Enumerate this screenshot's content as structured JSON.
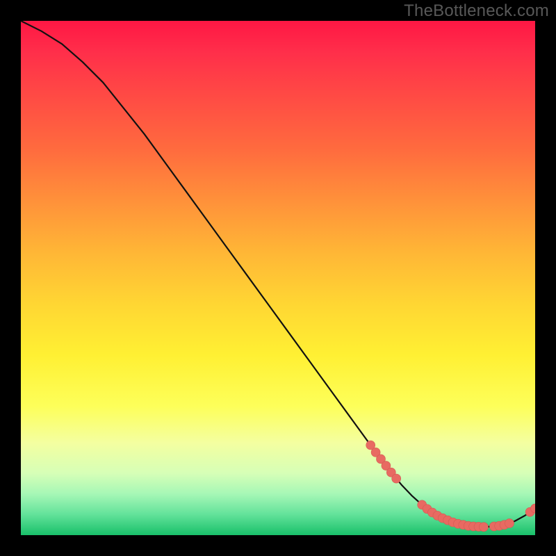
{
  "watermark": "TheBottleneck.com",
  "chart_data": {
    "type": "line",
    "title": "",
    "xlabel": "",
    "ylabel": "",
    "xlim": [
      0,
      100
    ],
    "ylim": [
      0,
      100
    ],
    "grid": false,
    "legend": false,
    "series": [
      {
        "name": "bottleneck-curve",
        "x": [
          0,
          4,
          8,
          12,
          16,
          20,
          24,
          28,
          32,
          36,
          40,
          44,
          48,
          52,
          56,
          60,
          64,
          68,
          70,
          72,
          74,
          76,
          78,
          80,
          82,
          84,
          86,
          88,
          90,
          92,
          94,
          96,
          98,
          100
        ],
        "y": [
          100,
          98,
          95.5,
          92,
          88,
          83,
          78,
          72.5,
          67,
          61.5,
          56,
          50.5,
          45,
          39.5,
          34,
          28.5,
          23,
          17.5,
          14.8,
          12.2,
          9.8,
          7.7,
          5.9,
          4.4,
          3.3,
          2.5,
          2.0,
          1.7,
          1.6,
          1.7,
          2.0,
          2.7,
          3.8,
          5.2
        ]
      }
    ],
    "markers": {
      "name": "highlight-points",
      "x": [
        68,
        69,
        70,
        71,
        72,
        73,
        78,
        79,
        80,
        81,
        82,
        83,
        84,
        85,
        86,
        87,
        88,
        89,
        90,
        92,
        93,
        94,
        95,
        99,
        100
      ],
      "y": [
        17.5,
        16.1,
        14.8,
        13.5,
        12.2,
        11.0,
        5.9,
        5.1,
        4.4,
        3.8,
        3.3,
        2.9,
        2.5,
        2.2,
        2.0,
        1.8,
        1.7,
        1.65,
        1.6,
        1.7,
        1.8,
        2.0,
        2.3,
        4.5,
        5.2
      ]
    }
  }
}
